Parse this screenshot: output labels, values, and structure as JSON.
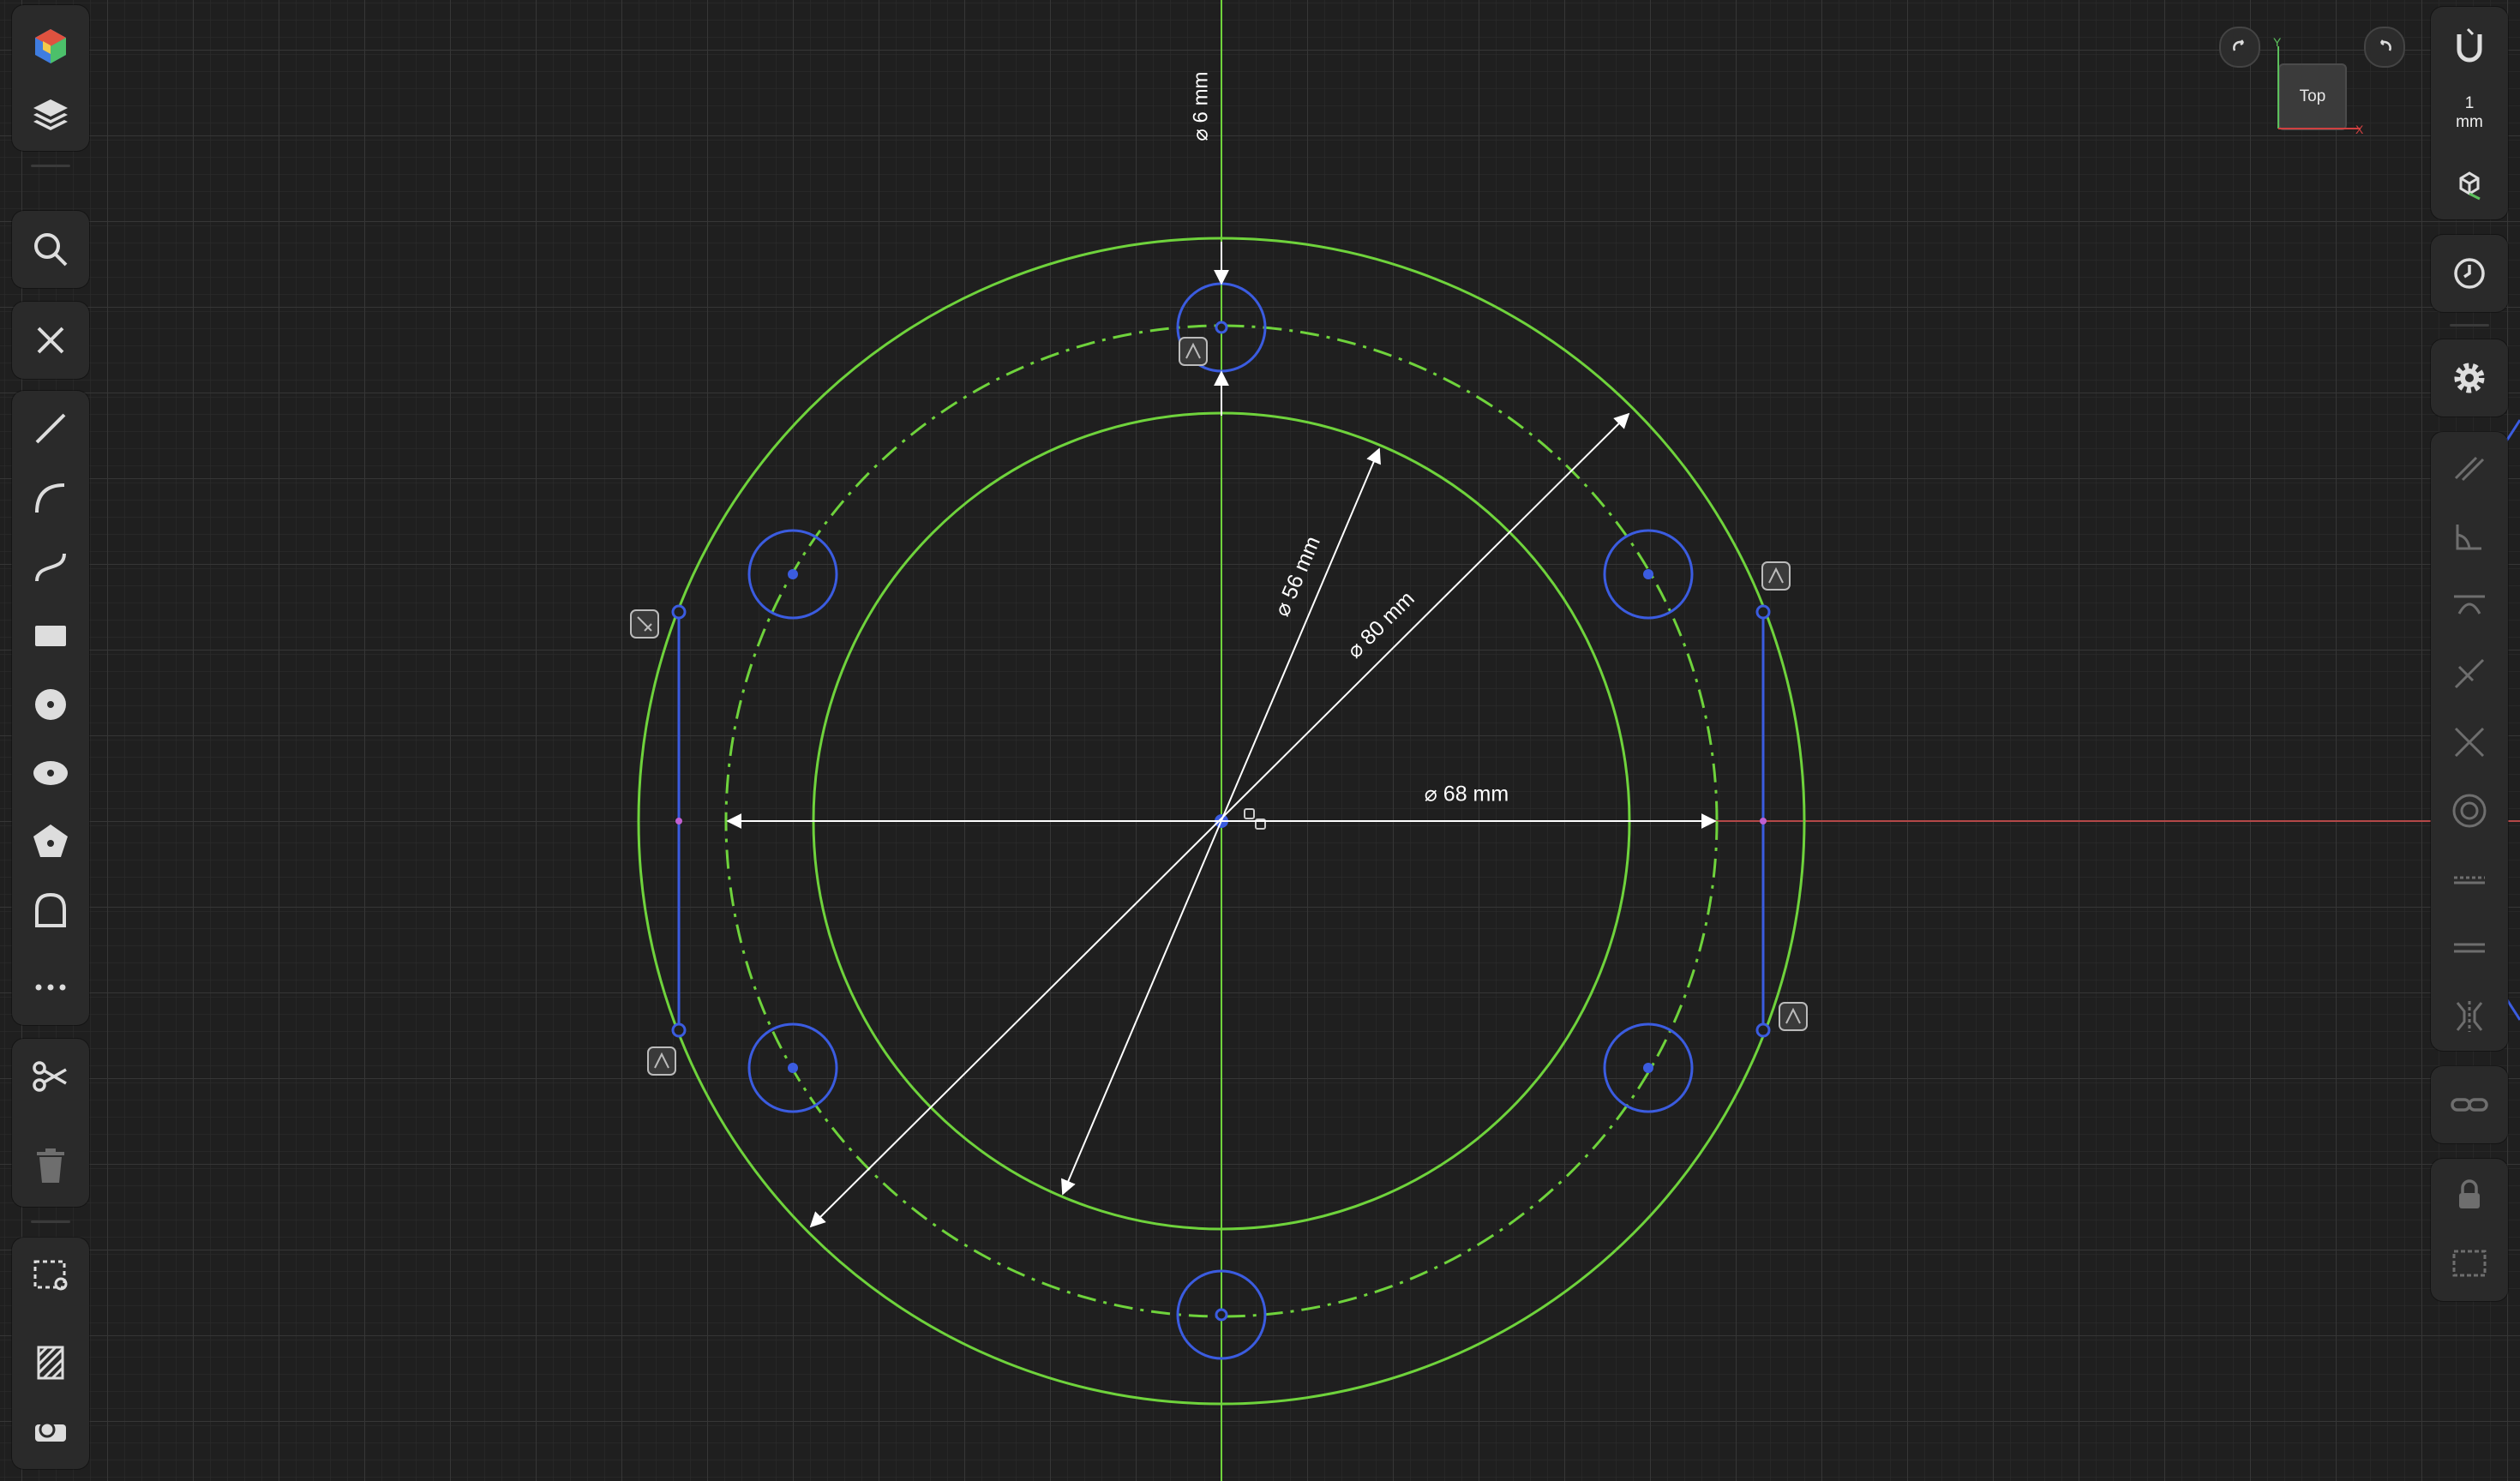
{
  "viewcube": {
    "face_label": "Top",
    "axis_x": "X",
    "axis_y": "Y"
  },
  "grid": {
    "unit_value": "1",
    "unit_label": "mm"
  },
  "dimensions": {
    "small_hole": "⌀ 6 mm",
    "inner_circle": "⌀ 56 mm",
    "outer_circle": "⌀ 80 mm",
    "bolt_circle": "⌀ 68 mm"
  },
  "left_toolbar": [
    "app-logo-icon",
    "layers-icon",
    "search-icon",
    "close-icon",
    "line-icon",
    "arc-icon",
    "spline-icon",
    "rectangle-icon",
    "circle-icon",
    "ellipse-icon",
    "polygon-icon",
    "slot-icon",
    "more-icon",
    "scissors-icon",
    "trash-icon",
    "select-box-icon",
    "hatch-icon",
    "measure-icon"
  ],
  "right_toolbar": [
    "snap-magnet-icon",
    "view-3d-icon",
    "history-icon",
    "settings-icon",
    "parallel-icon",
    "perpendicular-icon",
    "tangent-icon",
    "coincident-icon",
    "intersect-icon",
    "concentric-icon",
    "horizontal-icon",
    "equal-icon",
    "symmetric-icon",
    "link-icon",
    "lock-icon",
    "frame-icon"
  ],
  "colors": {
    "background": "#1f1f1f",
    "grid_minor": "#2b2b2b",
    "grid_major": "#383838",
    "geometry_green": "#6fd33c",
    "construction_blue": "#3b5ce0",
    "dimension_white": "#ffffff",
    "axis_red": "#b44848"
  }
}
